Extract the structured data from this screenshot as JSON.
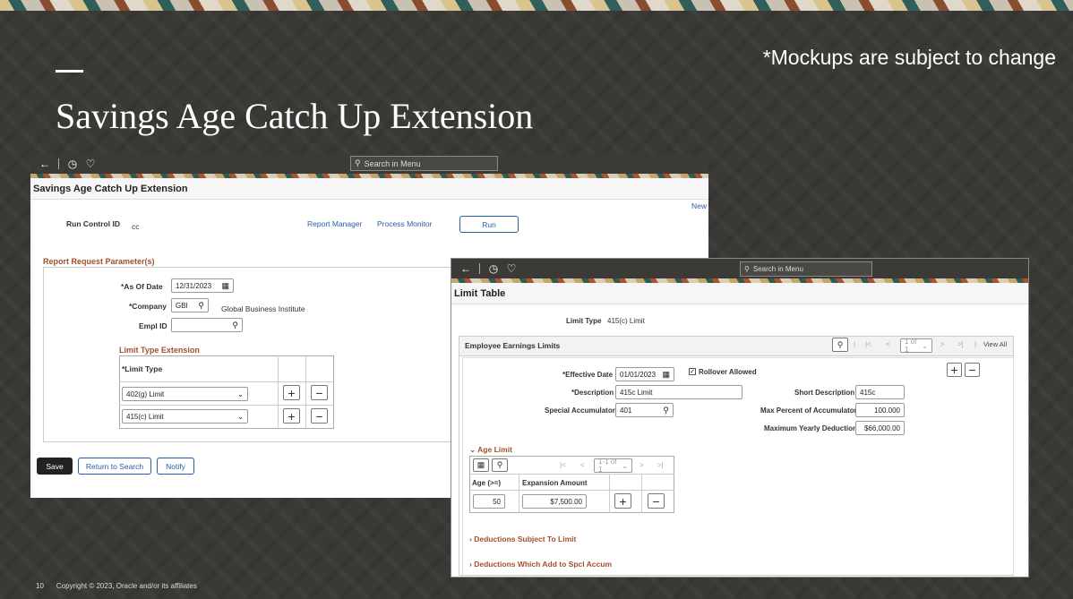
{
  "slide": {
    "disclaimer": "*Mockups are subject to change",
    "title": "Savings Age Catch Up Extension",
    "page_num": "10",
    "copyright": "Copyright © 2023, Oracle and/or its affiliates"
  },
  "win1": {
    "search_placeholder": "Search in Menu",
    "page_title": "Savings Age Catch Up Extension",
    "new_link": "New",
    "run_control_label": "Run Control ID",
    "run_control_value": "cc",
    "report_manager": "Report Manager",
    "process_monitor": "Process Monitor",
    "run_button": "Run",
    "params_title": "Report Request Parameter(s)",
    "as_of_date_label": "*As Of Date",
    "as_of_date_value": "12/31/2023",
    "company_label": "*Company",
    "company_value": "GBI",
    "company_desc": "Global Business Institute",
    "empl_id_label": "Empl ID",
    "limit_ext_title": "Limit Type Extension",
    "limit_type_header": "*Limit Type",
    "rows": [
      {
        "value": "402(g) Limit"
      },
      {
        "value": "415(c) Limit"
      }
    ],
    "save": "Save",
    "return_to_search": "Return to Search",
    "notify": "Notify"
  },
  "win2": {
    "search_placeholder": "Search in Menu",
    "page_title": "Limit Table",
    "limit_type_label": "Limit Type",
    "limit_type_value": "415(c) Limit",
    "section_title": "Employee Earnings Limits",
    "pager": "1 of 1",
    "view_all": "View All",
    "eff_date_label": "*Effective Date",
    "eff_date_value": "01/01/2023",
    "rollover_label": "Rollover Allowed",
    "desc_label": "*Description",
    "desc_value": "415c Limit",
    "short_desc_label": "Short Description",
    "short_desc_value": "415c",
    "spcl_acc_label": "Special Accumulator",
    "spcl_acc_value": "401",
    "max_pct_label": "Max Percent of Accumulator",
    "max_pct_value": "100.000",
    "max_yearly_label": "Maximum Yearly Deduction",
    "max_yearly_value": "$66,000.00",
    "age_limit_title": "Age Limit",
    "age_pager": "1-1 of 1",
    "age_header": "Age (>=)",
    "exp_header": "Expansion Amount",
    "age_value": "50",
    "exp_value": "$7,500.00",
    "ded_subject": "Deductions Subject To Limit",
    "ded_add": "Deductions Which Add to Spcl Accum"
  }
}
